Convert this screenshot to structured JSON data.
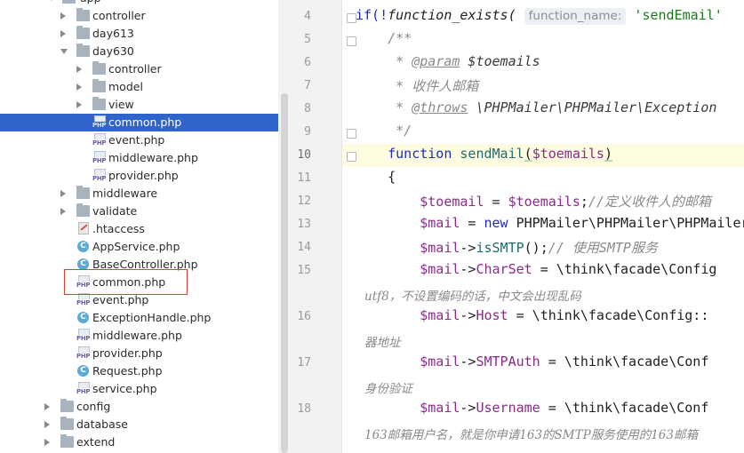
{
  "tree": {
    "items": [
      {
        "label": "app",
        "indent": 0,
        "kind": "folder",
        "state": "open"
      },
      {
        "label": "controller",
        "indent": 1,
        "kind": "folder",
        "state": "closed"
      },
      {
        "label": "day613",
        "indent": 1,
        "kind": "folder",
        "state": "closed"
      },
      {
        "label": "day630",
        "indent": 1,
        "kind": "folder",
        "state": "open"
      },
      {
        "label": "controller",
        "indent": 2,
        "kind": "folder",
        "state": "closed"
      },
      {
        "label": "model",
        "indent": 2,
        "kind": "folder",
        "state": "closed"
      },
      {
        "label": "view",
        "indent": 2,
        "kind": "folder",
        "state": "closed"
      },
      {
        "label": "common.php",
        "indent": 2,
        "kind": "php",
        "selected": true
      },
      {
        "label": "event.php",
        "indent": 2,
        "kind": "php"
      },
      {
        "label": "middleware.php",
        "indent": 2,
        "kind": "php"
      },
      {
        "label": "provider.php",
        "indent": 2,
        "kind": "php"
      },
      {
        "label": "middleware",
        "indent": 1,
        "kind": "folder",
        "state": "closed"
      },
      {
        "label": "validate",
        "indent": 1,
        "kind": "folder",
        "state": "closed"
      },
      {
        "label": ".htaccess",
        "indent": 1,
        "kind": "htaccess"
      },
      {
        "label": "AppService.php",
        "indent": 1,
        "kind": "class"
      },
      {
        "label": "BaseController.php",
        "indent": 1,
        "kind": "class"
      },
      {
        "label": "common.php",
        "indent": 1,
        "kind": "php",
        "highlighted": true
      },
      {
        "label": "event.php",
        "indent": 1,
        "kind": "php"
      },
      {
        "label": "ExceptionHandle.php",
        "indent": 1,
        "kind": "class"
      },
      {
        "label": "middleware.php",
        "indent": 1,
        "kind": "php"
      },
      {
        "label": "provider.php",
        "indent": 1,
        "kind": "php"
      },
      {
        "label": "Request.php",
        "indent": 1,
        "kind": "class"
      },
      {
        "label": "service.php",
        "indent": 1,
        "kind": "php"
      },
      {
        "label": "config",
        "indent": 0,
        "kind": "folder",
        "state": "closed"
      },
      {
        "label": "database",
        "indent": 0,
        "kind": "folder",
        "state": "closed"
      },
      {
        "label": "extend",
        "indent": 0,
        "kind": "folder",
        "state": "closed"
      }
    ],
    "php_badge": "PHP",
    "class_badge": "C"
  },
  "editor": {
    "line_numbers": [
      "4",
      "5",
      "6",
      "7",
      "8",
      "9",
      "10",
      "11",
      "12",
      "13",
      "14",
      "15",
      "16",
      "17",
      "18"
    ],
    "current_line": "10",
    "code": {
      "l4_if": "if(!",
      "l4_fn": "function_exists(",
      "l4_hint": "function_name:",
      "l4_str": "'sendEmail'",
      "l5": "    /**",
      "l6_star": "     * ",
      "l6_tag": "@param",
      "l6_var": " $toemails",
      "l7": "     * 收件人邮箱",
      "l8_star": "     * ",
      "l8_tag": "@throws",
      "l8_rest": " \\PHPMailer\\PHPMailer\\Exception",
      "l9": "     */",
      "l10_kw": "    function ",
      "l10_fn": "sendMail",
      "l10_p1": "(",
      "l10_var": "$toemails",
      "l10_p2": ")",
      "l11": "    {",
      "l12_var1": "        $toemail",
      "l12_eq": " = ",
      "l12_var2": "$toemails",
      "l12_semi": ";",
      "l12_cmt": "//定义收件人的邮箱",
      "l13_var": "        $mail",
      "l13_eq": " = ",
      "l13_kw": "new ",
      "l13_rest": "PHPMailer\\PHPMailer\\PHPMailer",
      "l14_var": "        $mail",
      "l14_arrow": "->",
      "l14_m": "isSMTP",
      "l14_p": "();",
      "l14_cmt": "// 使用SMTP服务",
      "l15_var": "        $mail",
      "l15_arrow": "->",
      "l15_prop": "CharSet",
      "l15_rest": " = \\think\\facade\\Config",
      "l15_wrap": "utf8，不设置编码的话，中文会出现乱码",
      "l16_var": "        $mail",
      "l16_arrow": "->",
      "l16_prop": "Host",
      "l16_rest": " = \\think\\facade\\Config::",
      "l16_wrap": "器地址",
      "l17_var": "        $mail",
      "l17_arrow": "->",
      "l17_prop": "SMTPAuth",
      "l17_rest": " = \\think\\facade\\Conf",
      "l17_wrap": "身份验证",
      "l18_var": "        $mail",
      "l18_arrow": "->",
      "l18_prop": "Username",
      "l18_rest": " = \\think\\facade\\Conf",
      "l18_wrap": "163邮箱用户名，就是你申请163的SMTP服务使用的163邮箱"
    }
  }
}
